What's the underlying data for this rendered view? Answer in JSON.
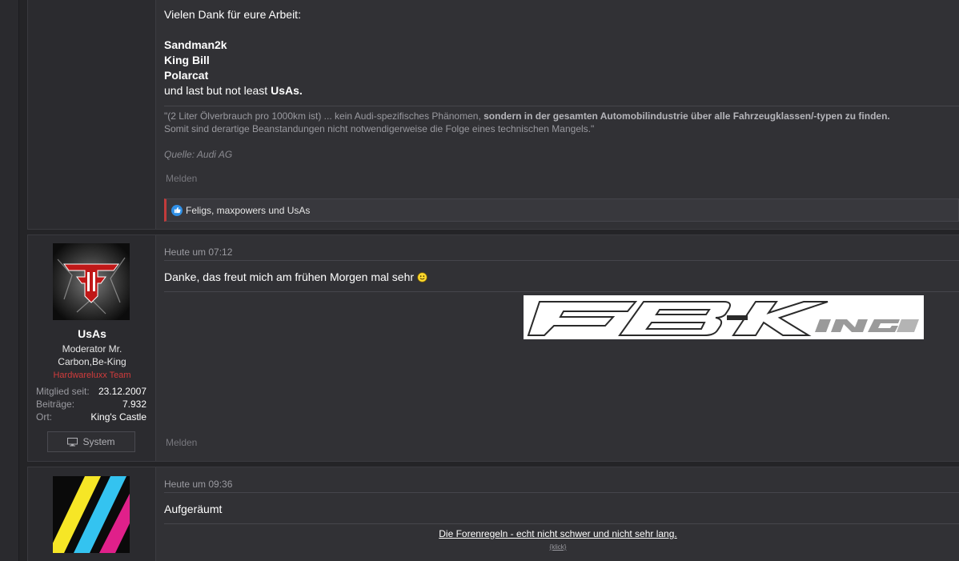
{
  "post1": {
    "intro": "Vielen Dank für eure Arbeit:",
    "names": [
      "Sandman2k",
      "King Bill",
      "Polarcat"
    ],
    "closing_prefix": "und last but not least ",
    "closing_name": "UsAs",
    "closing_suffix": ".",
    "quote_line1_normal": "\"(2 Liter Ölverbrauch pro 1000km ist) ... kein Audi-spezifisches Phänomen, ",
    "quote_line1_bold": "sondern in der gesamten Automobilindustrie über alle Fahrzeugklassen/-typen zu finden.",
    "quote_line2": "Somit sind derartige Beanstandungen nicht notwendigerweise die Folge eines technischen Mangels.\"",
    "quote_source": "Quelle: Audi AG",
    "report": "Melden",
    "reactions": "Feligs, maxpowers und UsAs"
  },
  "post2": {
    "date": "Heute um 07:12",
    "message": "Danke, das freut mich am frühen Morgen mal sehr",
    "report": "Melden",
    "user": {
      "name": "UsAs",
      "title_line1": "Moderator Mr.",
      "title_line2": "Carbon,Be-King",
      "banner": "Hardwareluxx Team",
      "stats": [
        {
          "label": "Mitglied seit:",
          "value": "23.12.2007"
        },
        {
          "label": "Beiträge:",
          "value": "7.932"
        },
        {
          "label": "Ort:",
          "value": "King's Castle"
        }
      ],
      "system_button": "System"
    }
  },
  "post3": {
    "date": "Heute um 09:36",
    "message": "Aufgeräumt",
    "signature_link": "Die Forenregeln - echt nicht schwer und nicht sehr lang.",
    "signature_sub": "{klick}"
  },
  "colors": {
    "background": "#242427",
    "post_bg": "#313135",
    "user_col_bg": "#2b2b2f",
    "accent_red": "#c23b3b",
    "like_blue": "#2f8fe6"
  },
  "icons": {
    "like": "thumbs-up-icon",
    "smiley": "smiley-icon",
    "system": "monitor-icon"
  }
}
